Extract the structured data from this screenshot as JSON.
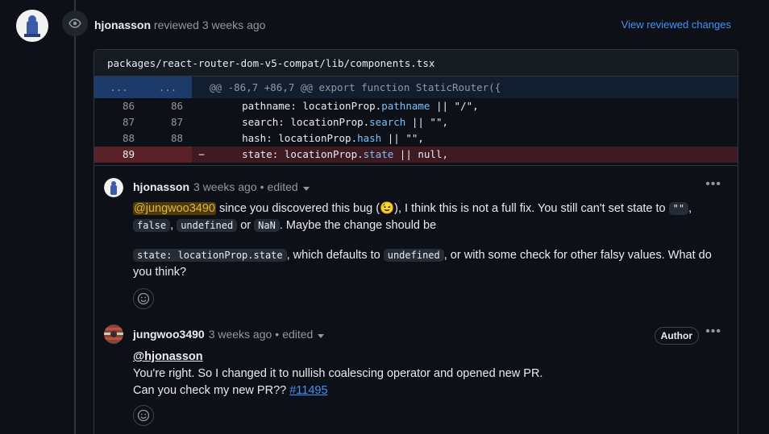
{
  "review": {
    "author": "hjonasson",
    "action": "reviewed",
    "time": "3 weeks ago",
    "view_changes": "View reviewed changes"
  },
  "file": {
    "path": "packages/react-router-dom-v5-compat/lib/components.tsx",
    "hunk_left": "...",
    "hunk_right": "...",
    "hunk_header": "@@ -86,7 +86,7 @@ export function StaticRouter({",
    "lines": [
      {
        "old": "86",
        "new": "86",
        "sign": "",
        "key": "pathname",
        "mid": ": locationProp.",
        "prop": "pathname",
        "rest": " || \"/\","
      },
      {
        "old": "87",
        "new": "87",
        "sign": "",
        "key": "search",
        "mid": ": locationProp.",
        "prop": "search",
        "rest": " || \"\","
      },
      {
        "old": "88",
        "new": "88",
        "sign": "",
        "key": "hash",
        "mid": ": locationProp.",
        "prop": "hash",
        "rest": " || \"\","
      },
      {
        "old": "89",
        "new": "",
        "sign": "−",
        "key": "state",
        "mid": ": locationProp.",
        "prop": "state",
        "rest": " || null,"
      }
    ]
  },
  "comments": [
    {
      "author": "hjonasson",
      "time": "3 weeks ago",
      "edited": "edited",
      "mention": "@jungwoo3490",
      "p1a": " since you discovered this bug (",
      "emoji": "😉",
      "p1b": "), I think this is not a full fix. You still can't set state to ",
      "code_empty": "\"\"",
      "comma": ",",
      "code_false": "false",
      "comma2": ",",
      "code_undefined": "undefined",
      "or": " or ",
      "code_nan": "NaN",
      "p1c": ". Maybe the change should be",
      "code_state": "state: locationProp.state",
      "p2a": ", which defaults to ",
      "code_undefined2": "undefined",
      "p2b": ", or with some check for other falsy values. What do you think?"
    },
    {
      "author": "jungwoo3490",
      "time": "3 weeks ago",
      "edited": "edited",
      "badge": "Author",
      "mention": "@hjonasson",
      "line1": "You're right. So I changed it to nullish coalescing operator and opened new PR.",
      "line2": "Can you check my new PR?? ",
      "pr_link": "#11495"
    }
  ],
  "icons": {
    "eye": "eye-icon",
    "kebab": "kebab-icon",
    "smiley": "smiley-icon"
  },
  "colors": {
    "link": "#4493f8",
    "deletion_bg": "#3f1b21",
    "hunk_bg": "#121d2f"
  }
}
